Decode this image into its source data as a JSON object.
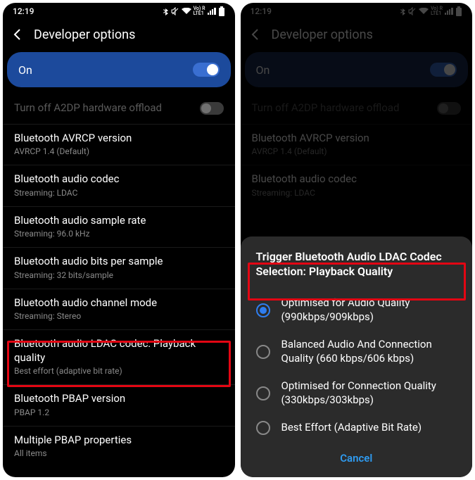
{
  "status": {
    "time": "12:19",
    "net_label": "Vo) R\nLTE1",
    "icons": [
      "bluetooth",
      "mute",
      "wifi",
      "signal",
      "battery"
    ]
  },
  "left": {
    "header_title": "Developer options",
    "on_label": "On",
    "items": [
      {
        "label": "Turn off A2DP hardware offload",
        "sub": "",
        "muted": true,
        "offload": true
      },
      {
        "label": "Bluetooth AVRCP version",
        "sub": "AVRCP 1.4 (Default)"
      },
      {
        "label": "Bluetooth audio codec",
        "sub": "Streaming: LDAC"
      },
      {
        "label": "Bluetooth audio sample rate",
        "sub": "Streaming: 96.0 kHz"
      },
      {
        "label": "Bluetooth audio bits per sample",
        "sub": "Streaming: 32 bits/sample"
      },
      {
        "label": "Bluetooth audio channel mode",
        "sub": "Streaming: Stereo"
      },
      {
        "label": "Bluetooth audio LDAC codec: Playback quality",
        "sub": "Best effort (adaptive bit rate)"
      },
      {
        "label": "Bluetooth PBAP version",
        "sub": "PBAP 1.2"
      },
      {
        "label": "Multiple PBAP properties",
        "sub": "All items"
      }
    ]
  },
  "right": {
    "header_title": "Developer options",
    "on_label": "On",
    "items": [
      {
        "label": "Turn off A2DP hardware offload",
        "sub": "",
        "muted": true,
        "offload": true
      },
      {
        "label": "Bluetooth AVRCP version",
        "sub": "AVRCP 1.4 (Default)"
      },
      {
        "label": "Bluetooth audio codec",
        "sub": "Streaming: LDAC"
      }
    ],
    "sheet_title": "Trigger Bluetooth Audio LDAC Codec Selection: Playback Quality",
    "options": [
      "Optimised for Audio Quality (990kbps/909kbps)",
      "Balanced Audio And Connection Quality (660 kbps/606 kbps)",
      "Optimised for Connection Quality (330kbps/303kbps)",
      "Best Effort (Adaptive Bit Rate)"
    ],
    "selected_index": 0,
    "cancel_label": "Cancel"
  }
}
